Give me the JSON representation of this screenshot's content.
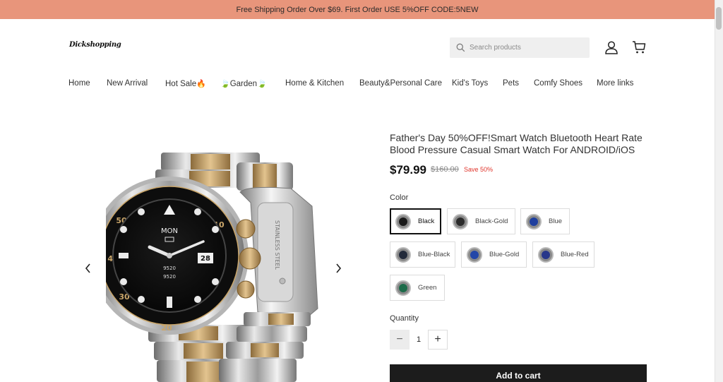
{
  "announcement": "Free Shipping Order Over $69. First Order USE 5%OFF CODE:5NEW",
  "header": {
    "logo_text": "Dickshopping",
    "search_placeholder": "Search products"
  },
  "nav": [
    {
      "label": "Home"
    },
    {
      "label": "New Arrival"
    },
    {
      "label": "Hot Sale"
    },
    {
      "label": "Garden"
    },
    {
      "label": "Home & Kitchen"
    },
    {
      "label": "Beauty&Personal Care"
    },
    {
      "label": "Kid's Toys"
    },
    {
      "label": "Pets"
    },
    {
      "label": "Comfy Shoes"
    },
    {
      "label": "More links"
    }
  ],
  "gallery": {
    "dial_day": "MON",
    "dial_date": "28",
    "dial_steps": "9520",
    "dial_heart": "9520",
    "bracelet_engraving": "STAINLESS STEEL"
  },
  "product": {
    "title": "Father's Day 50%OFF!Smart Watch Bluetooth Heart Rate Blood Pressure Casual Smart Watch For ANDROID/iOS",
    "price": "$79.99",
    "compare_price": "$160.00",
    "save_label": "Save 50%"
  },
  "color": {
    "label": "Color",
    "selected": "Black",
    "options": [
      {
        "name": "Black",
        "dial": "#1a1a1a"
      },
      {
        "name": "Black-Gold",
        "dial": "#2b2b2b"
      },
      {
        "name": "Blue",
        "dial": "#1f3f9e"
      },
      {
        "name": "Blue-Black",
        "dial": "#222a3a"
      },
      {
        "name": "Blue-Gold",
        "dial": "#2346a8"
      },
      {
        "name": "Blue-Red",
        "dial": "#28378a"
      },
      {
        "name": "Green",
        "dial": "#1d6b4a"
      }
    ]
  },
  "quantity": {
    "label": "Quantity",
    "value": "1",
    "minus": "−",
    "plus": "+"
  },
  "add_to_cart": "Add to cart",
  "colors": {
    "announcement_bg": "#e8957b",
    "button_bg": "#1c1c1c",
    "sale": "#e0342b"
  }
}
